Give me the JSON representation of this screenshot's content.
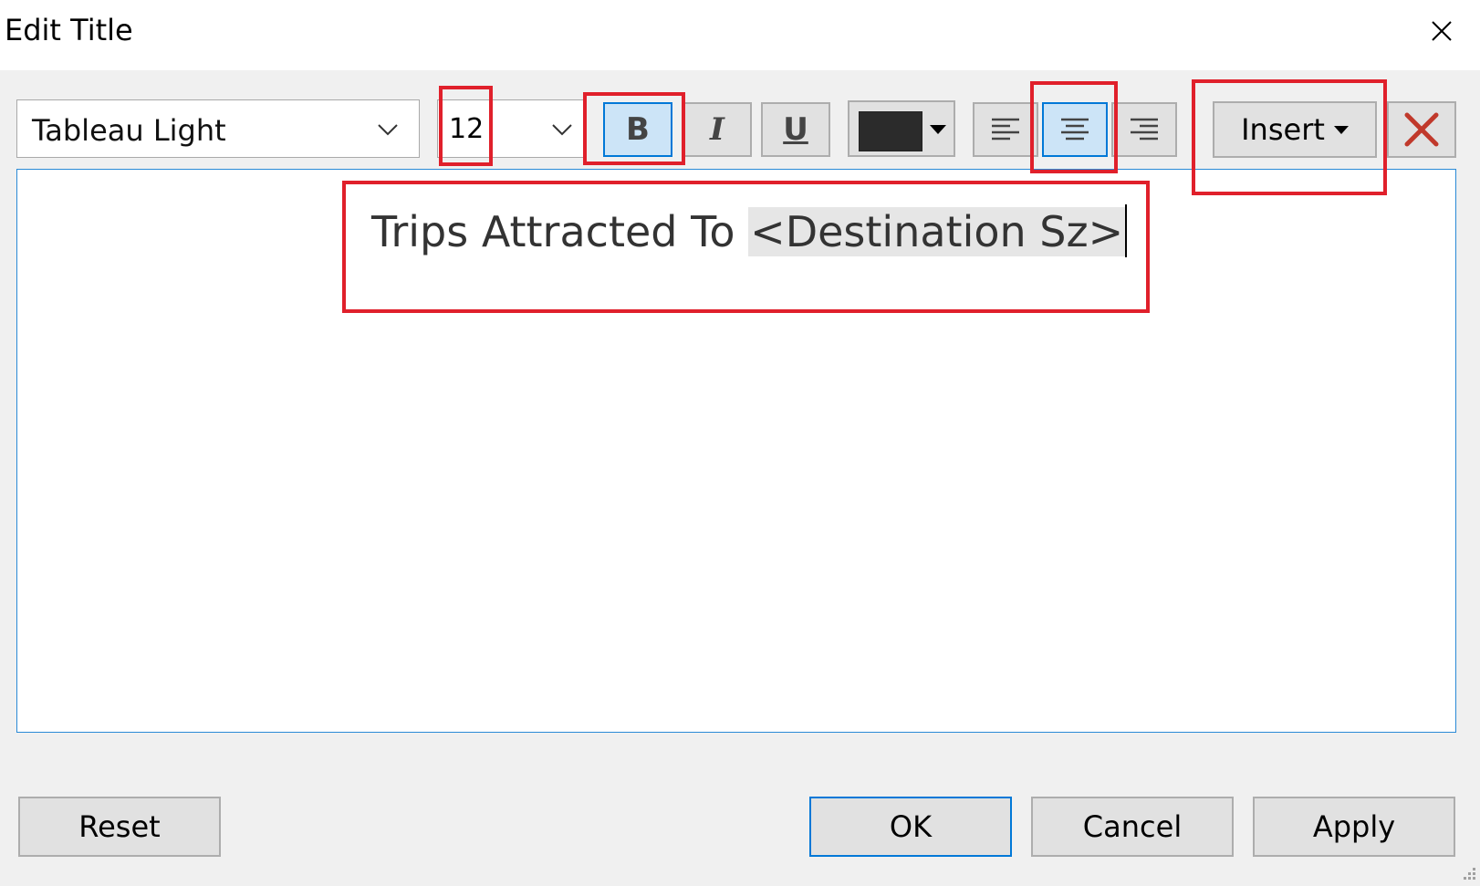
{
  "window": {
    "title": "Edit Title"
  },
  "toolbar": {
    "font_family": "Tableau Light",
    "font_size": "12",
    "bold_label": "B",
    "italic_label": "I",
    "underline_label": "U",
    "text_color": "#2b2b2b",
    "align": "center",
    "insert_label": "Insert",
    "clear_icon": "red-x-icon"
  },
  "editor": {
    "static_text": "Trips Attracted To ",
    "field_token": "<Destination Sz>"
  },
  "footer": {
    "reset_label": "Reset",
    "ok_label": "OK",
    "cancel_label": "Cancel",
    "apply_label": "Apply"
  },
  "colors": {
    "annotation": "#e0202b",
    "active_accent": "#0078d7",
    "active_fill": "#cce4f7"
  }
}
